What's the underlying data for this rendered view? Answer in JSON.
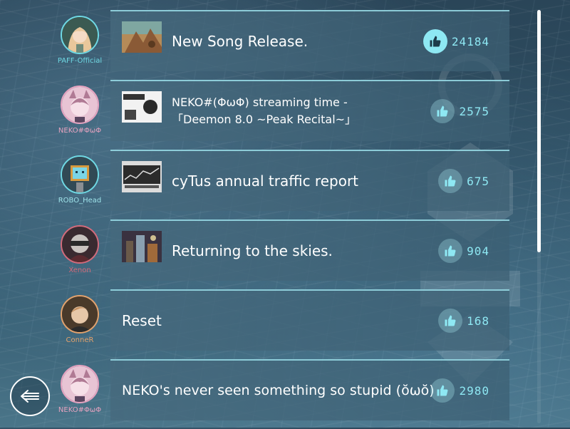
{
  "feed": {
    "posts": [
      {
        "author": "PAFF-Official",
        "title": "New Song Release.",
        "likes": "24184",
        "liked": true,
        "name_color": "#6fd9e4"
      },
      {
        "author": "NEKO#ΦωΦ",
        "title": "NEKO#(ΦωΦ) streaming time -\n「Deemon 8.0 ~Peak Recital~」",
        "likes": "2575",
        "liked": false,
        "name_color": "#e6a3c0"
      },
      {
        "author": "ROBO_Head",
        "title": "cyTus annual traffic report",
        "likes": "675",
        "liked": false,
        "name_color": "#9fe3ea"
      },
      {
        "author": "Xenon",
        "title": "Returning to the skies.",
        "likes": "904",
        "liked": false,
        "name_color": "#d46a7a"
      },
      {
        "author": "ConneR",
        "title": "Reset",
        "likes": "168",
        "liked": false,
        "name_color": "#e4a26c"
      },
      {
        "author": "NEKO#ΦωΦ",
        "title": "NEKO's never seen something so stupid (ŏωŏ)",
        "likes": "2980",
        "liked": false,
        "name_color": "#e6a3c0"
      }
    ]
  },
  "colors": {
    "accent": "#8ee8f3",
    "card_border": "#a0e6f0"
  },
  "icons": {
    "like": "thumbs-up-icon",
    "back": "back-arrow-icon"
  }
}
